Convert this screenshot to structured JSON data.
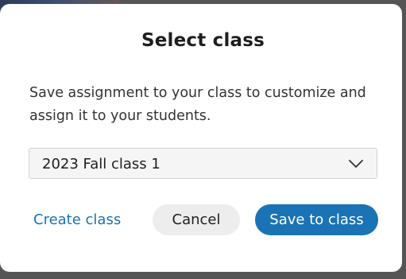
{
  "modal": {
    "title": "Select class",
    "description": "Save assignment to your class to customize and assign it to your students.",
    "class_select": {
      "selected_value": "2023 Fall class 1",
      "icon": "chevron-down-icon"
    },
    "create_class_label": "Create class",
    "cancel_label": "Cancel",
    "save_label": "Save to class"
  },
  "colors": {
    "accent": "#1a73b5",
    "backdrop": "#555555",
    "cancel_bg": "#ededed"
  }
}
